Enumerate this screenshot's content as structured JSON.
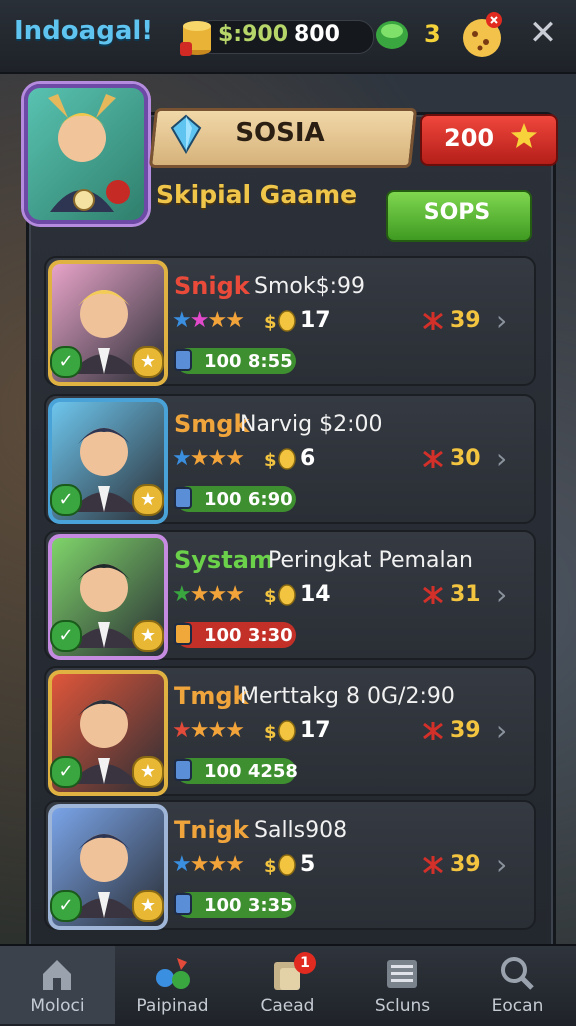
{
  "header": {
    "app_title": "Indoagal!",
    "coin_amount": "$:900",
    "coin_amount_2": "800",
    "gem_count": "3"
  },
  "hero": {
    "banner_label": "SOSIA",
    "score_value": "200",
    "subtitle": "Skipial Gaame",
    "action_label": "SOPS"
  },
  "cards": [
    {
      "name": "Snigk",
      "name_color": "red",
      "subtitle": "Smok$:99",
      "rating": 4,
      "stat": "17",
      "bug_value": "39",
      "xp_value": "100",
      "xp_time": "8:55",
      "xp_color": "green"
    },
    {
      "name": "Smgk",
      "name_color": "orange",
      "subtitle": "Narvig $2:00",
      "rating": 4,
      "stat": "6",
      "bug_value": "30",
      "xp_value": "100",
      "xp_time": "6:90",
      "xp_color": "green"
    },
    {
      "name": "Systam",
      "name_color": "green",
      "subtitle": "Peringkat Pemalan",
      "rating": 4,
      "stat": "14",
      "bug_value": "31",
      "xp_value": "100",
      "xp_time": "3:30",
      "xp_color": "red"
    },
    {
      "name": "Tmgk",
      "name_color": "orange",
      "subtitle": "Merttakg 8 0G/2:90",
      "rating": 4,
      "stat": "17",
      "bug_value": "39",
      "xp_value": "100",
      "xp_time": "4258",
      "xp_color": "green"
    },
    {
      "name": "Tnigk",
      "name_color": "orange",
      "subtitle": "Salls908",
      "rating": 4,
      "stat": "5",
      "bug_value": "39",
      "xp_value": "100",
      "xp_time": "3:35",
      "xp_color": "green"
    }
  ],
  "tabs": [
    {
      "label": "Moloci",
      "icon": "home-icon",
      "active": true
    },
    {
      "label": "Paipinad",
      "icon": "team-icon",
      "active": false
    },
    {
      "label": "Caead",
      "icon": "cards-icon",
      "active": false,
      "badge": "1"
    },
    {
      "label": "Scluns",
      "icon": "list-icon",
      "active": false
    },
    {
      "label": "Eocan",
      "icon": "search-icon",
      "active": false
    }
  ],
  "colors": {
    "title": "#5fc4ef",
    "score_button": "#d7312a",
    "action_button": "#5fb938",
    "subtitle": "#f0c64a"
  }
}
